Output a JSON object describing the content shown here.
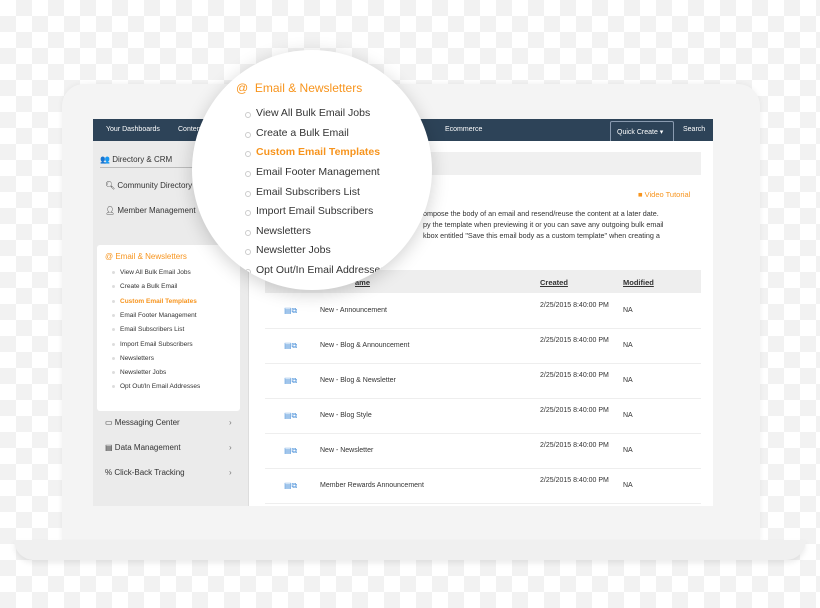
{
  "nav": {
    "items": [
      "Your Dashboards",
      "Content",
      "Ecommerce"
    ],
    "quick_create": "Quick Create ▾",
    "search": "Search"
  },
  "sidebar": {
    "directory": "Directory & CRM",
    "community": "Community Directory",
    "member": "Member Management",
    "email_header": "Email & Newsletters",
    "email_items": [
      "View All Bulk Email Jobs",
      "Create a Bulk Email",
      "Custom Email Templates",
      "Email Footer Management",
      "Email Subscribers List",
      "Import Email Subscribers",
      "Newsletters",
      "Newsletter Jobs",
      "Opt Out/In Email Addresses"
    ],
    "active_index": 2,
    "sections": [
      "Messaging Center",
      "Data Management",
      "Click-Back Tracking"
    ]
  },
  "main": {
    "video_tutorial": "Video Tutorial",
    "description": [
      "ompose the body of an email and resend/reuse the content at a later date.",
      "py the template when previewing it or you can save any outgoing bulk email",
      "kbox entitled \"Save this email body as a custom template\" when creating a"
    ],
    "columns": [
      "ame",
      "Created",
      "Modified"
    ],
    "rows": [
      {
        "name": "New - Announcement",
        "created": "2/25/2015 8:40:00 PM",
        "modified": "NA"
      },
      {
        "name": "New - Blog & Announcement",
        "created": "2/25/2015 8:40:00 PM",
        "modified": "NA"
      },
      {
        "name": "New - Blog & Newsletter",
        "created": "2/25/2015 8:40:00 PM",
        "modified": "NA"
      },
      {
        "name": "New - Blog Style",
        "created": "2/25/2015 8:40:00 PM",
        "modified": "NA"
      },
      {
        "name": "New - Newsletter",
        "created": "2/25/2015 8:40:00 PM",
        "modified": "NA"
      },
      {
        "name": "Member Rewards Announcement",
        "created": "2/25/2015 8:40:00 PM",
        "modified": "NA"
      }
    ]
  },
  "colors": {
    "accent": "#f7941d",
    "nav": "#2d4358"
  }
}
